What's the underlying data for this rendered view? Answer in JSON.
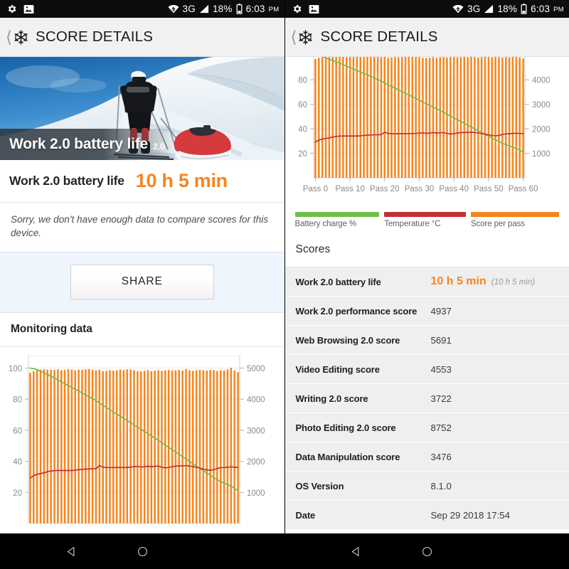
{
  "status_bar": {
    "icons_left": [
      "gear-icon",
      "image-icon"
    ],
    "wifi_icon": "wifi-icon",
    "network": "3G",
    "signal_icon": "signal-bars-icon",
    "battery_percent": "18%",
    "battery_icon": "battery-low-icon",
    "time": "6:03",
    "meridiem": "PM"
  },
  "app_bar": {
    "back_icon": "back-chevron-icon",
    "app_icon": "snowflake-icon",
    "title": "SCORE DETAILS"
  },
  "left_panel": {
    "hero": {
      "title": "Work 2.0 battery life",
      "subtitle": "2.0",
      "image_alt": "skier-pulling-sled-in-snow"
    },
    "result": {
      "label": "Work 2.0 battery life",
      "value": "10 h 5 min"
    },
    "note": "Sorry, we don't have enough data to compare scores for this device.",
    "share_label": "SHARE",
    "monitoring_title": "Monitoring data"
  },
  "right_panel": {
    "scores_title": "Scores",
    "rows": [
      {
        "key": "Work 2.0 battery life",
        "value": "10 h 5 min",
        "note": "(10 h 5 min)",
        "highlight": true
      },
      {
        "key": "Work 2.0 performance score",
        "value": "4937",
        "note": "",
        "highlight": false
      },
      {
        "key": "Web Browsing 2.0 score",
        "value": "5691",
        "note": "",
        "highlight": false
      },
      {
        "key": "Video Editing score",
        "value": "4553",
        "note": "",
        "highlight": false
      },
      {
        "key": "Writing 2.0 score",
        "value": "3722",
        "note": "",
        "highlight": false
      },
      {
        "key": "Photo Editing 2.0 score",
        "value": "8752",
        "note": "",
        "highlight": false
      },
      {
        "key": "Data Manipulation score",
        "value": "3476",
        "note": "",
        "highlight": false
      },
      {
        "key": "OS Version",
        "value": "8.1.0",
        "note": "",
        "highlight": false
      },
      {
        "key": "Date",
        "value": "Sep 29 2018 17:54",
        "note": "",
        "highlight": false
      }
    ]
  },
  "legend": [
    {
      "label": "Battery charge %",
      "color": "#6cc04a"
    },
    {
      "label": "Temperature °C",
      "color": "#c42f38"
    },
    {
      "label": "Score per pass",
      "color": "#f5851f"
    }
  ],
  "nav_bar": {
    "back": "nav-back-icon",
    "home": "nav-home-icon"
  },
  "colors": {
    "accent_orange": "#f5851f",
    "battery_green": "#6cc04a",
    "temperature_red": "#c42f38",
    "appbar_bg": "#f1f1f1",
    "share_strip_bg": "#eef5fd",
    "row_bg": "#efefef"
  },
  "chart_data": {
    "type": "bar",
    "title": "Monitoring data",
    "xlabel": "",
    "ylabel": "Battery charge % / Temperature °C",
    "y2label": "Score per pass",
    "xtick_labels": [
      "Pass 0",
      "Pass 10",
      "Pass 20",
      "Pass 30",
      "Pass 40",
      "Pass 50",
      "Pass 60"
    ],
    "xticks": [
      0,
      10,
      20,
      30,
      40,
      50,
      60
    ],
    "ylim": [
      0,
      108
    ],
    "yticks": [
      20,
      40,
      60,
      80,
      100
    ],
    "y2lim": [
      0,
      5400
    ],
    "y2ticks": [
      1000,
      2000,
      3000,
      4000,
      5000
    ],
    "grid": true,
    "legend_position": "below",
    "n_passes": 61,
    "series": [
      {
        "name": "Score per pass",
        "type": "bar",
        "color": "#f5851f",
        "axis": "right",
        "values": [
          4850,
          4900,
          4930,
          4950,
          4960,
          4950,
          4950,
          4940,
          4960,
          4930,
          4940,
          4960,
          4950,
          4930,
          4950,
          4940,
          4960,
          4970,
          4940,
          4930,
          4950,
          4900,
          4910,
          4930,
          4920,
          4930,
          4950,
          4940,
          4960,
          4950,
          4930,
          4900,
          4890,
          4910,
          4930,
          4900,
          4920,
          4930,
          4910,
          4930,
          4940,
          4920,
          4930,
          4940,
          4920,
          4970,
          4930,
          4910,
          4930,
          4940,
          4930,
          4920,
          4940,
          4930,
          4910,
          4930,
          4920,
          4960,
          5010,
          4920,
          4870
        ]
      },
      {
        "name": "Battery charge %",
        "type": "line",
        "color": "#6cc04a",
        "axis": "left",
        "values": [
          100,
          99.6,
          99.0,
          98.0,
          96.8,
          95.8,
          94.7,
          93.6,
          92.4,
          91.2,
          90.0,
          88.8,
          87.6,
          86.4,
          85.2,
          84.0,
          82.8,
          81.6,
          80.4,
          79.0,
          77.6,
          76.0,
          74.6,
          73.2,
          71.8,
          70.4,
          69.0,
          67.6,
          66.2,
          64.8,
          63.4,
          62.0,
          60.6,
          59.2,
          57.8,
          56.4,
          55.0,
          53.5,
          52.0,
          50.5,
          49.0,
          47.5,
          46.0,
          44.5,
          43.0,
          41.5,
          40.0,
          38.5,
          37.0,
          35.5,
          34.0,
          32.5,
          31.0,
          29.6,
          28.2,
          27.0,
          26.0,
          25.0,
          24.0,
          22.6,
          21.0
        ]
      },
      {
        "name": "Temperature °C",
        "type": "line",
        "color": "#c42f38",
        "axis": "left",
        "values": [
          29.2,
          30.8,
          31.6,
          32.1,
          32.6,
          33.3,
          33.8,
          34.0,
          34.1,
          34.1,
          34.1,
          34.1,
          34.1,
          34.3,
          34.6,
          34.8,
          35.0,
          35.1,
          35.2,
          35.2,
          37.3,
          36.2,
          36.0,
          36.0,
          36.0,
          36.1,
          36.0,
          36.0,
          36.1,
          36.2,
          36.6,
          36.7,
          36.3,
          36.5,
          36.9,
          36.5,
          36.8,
          36.9,
          36.2,
          35.8,
          36.0,
          36.6,
          36.9,
          37.0,
          37.1,
          37.2,
          37.0,
          36.6,
          36.2,
          35.6,
          35.0,
          34.5,
          34.3,
          34.6,
          35.4,
          35.9,
          36.0,
          36.2,
          36.4,
          36.2,
          36.1
        ]
      }
    ]
  }
}
